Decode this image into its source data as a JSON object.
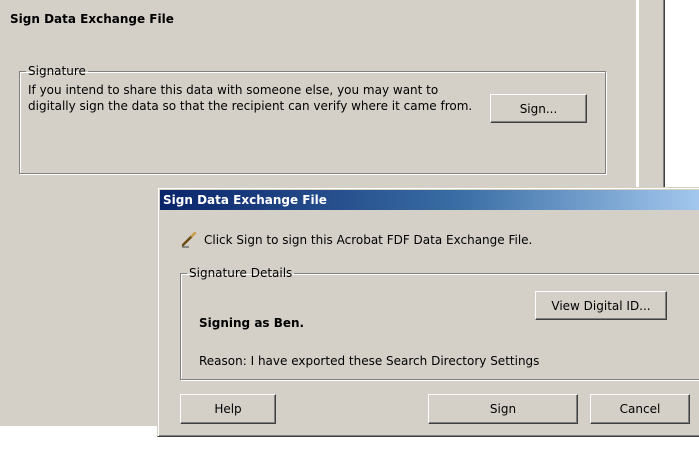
{
  "background_page": {
    "title": "Sign Data Exchange File",
    "signature_group": {
      "legend": "Signature",
      "description": "If you intend to share this data with someone else, you may want to digitally sign the data so that the recipient can verify where it came from.",
      "sign_button": "Sign..."
    }
  },
  "dialog": {
    "title": "Sign Data Exchange File",
    "icon": "pen-icon",
    "instruction": "Click Sign to sign this Acrobat FDF Data Exchange File.",
    "details_group": {
      "legend": "Signature Details",
      "signing_as": "Signing as Ben.",
      "view_id_button": "View Digital ID...",
      "reason": "Reason: I have exported these Search Directory Settings"
    },
    "buttons": {
      "help": "Help",
      "sign": "Sign",
      "cancel": "Cancel"
    }
  },
  "colors": {
    "window_bg": "#d4d0c8",
    "titlebar_start": "#0a246a",
    "titlebar_end": "#a6caf0"
  }
}
